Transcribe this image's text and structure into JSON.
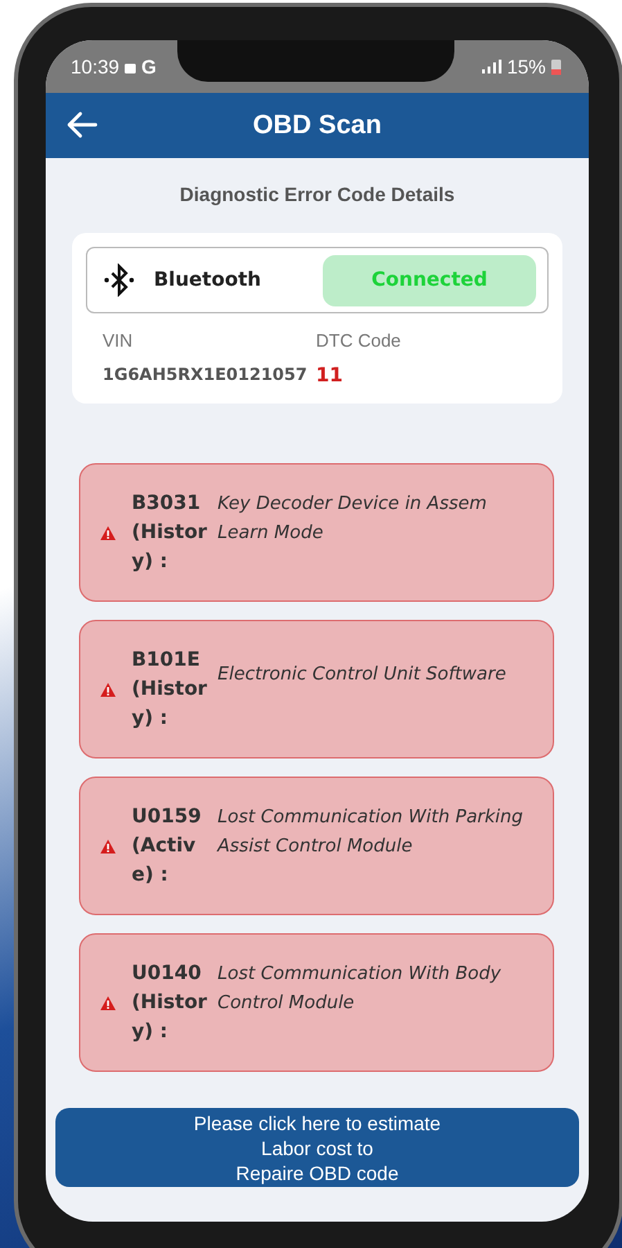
{
  "status_bar": {
    "time": "10:39",
    "carrier_letter": "G",
    "battery": "15%"
  },
  "app_bar": {
    "title": "OBD Scan"
  },
  "subtitle": "Diagnostic Error Code Details",
  "connection": {
    "label": "Bluetooth",
    "status": "Connected",
    "connected": true
  },
  "vehicle": {
    "vin_label": "VIN",
    "vin": "1G6AH5RX1E0121057",
    "dtc_label": "DTC Code",
    "dtc_count": "11"
  },
  "codes": [
    {
      "code": "B3031 (History) :",
      "description": "Key Decoder Device in Assem Learn Mode"
    },
    {
      "code": "B101E (History) :",
      "description": "Electronic Control Unit Software"
    },
    {
      "code": "U0159 (Active) :",
      "description": "Lost Communication With Parking Assist Control Module"
    },
    {
      "code": "U0140 (History) :",
      "description": "Lost Communication With Body Control Module"
    }
  ],
  "estimate_button": {
    "lines": [
      "Please click here to estimate",
      "Labor cost to",
      "Repaire OBD code"
    ]
  }
}
